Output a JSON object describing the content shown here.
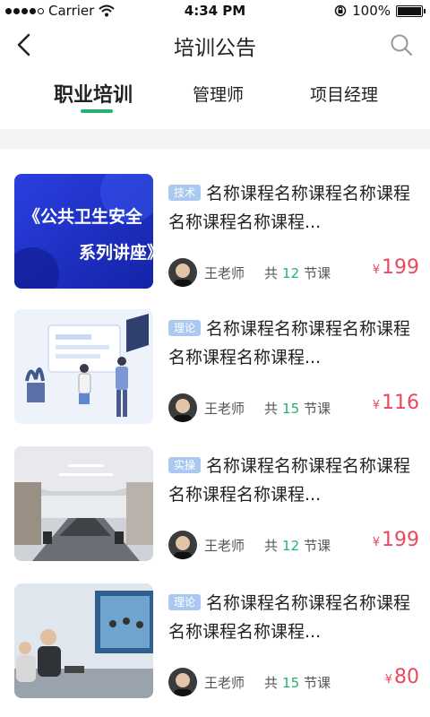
{
  "status_bar": {
    "carrier": "Carrier",
    "time": "4:34 PM",
    "battery": "100%"
  },
  "header": {
    "title": "培训公告",
    "back_icon": "back-icon",
    "search_icon": "search-icon"
  },
  "tabs": [
    {
      "label": "职业培训",
      "active": true
    },
    {
      "label": "管理师",
      "active": false
    },
    {
      "label": "项目经理",
      "active": false
    }
  ],
  "courses": [
    {
      "tag": "技术",
      "title": "名称课程名称课程名称课程名称课程名称课程...",
      "teacher": "王老师",
      "lessons_prefix": "共",
      "lessons_count": "12",
      "lessons_suffix": "节课",
      "currency": "¥",
      "price": "199",
      "thumb_text_line1": "《公共卫生安全",
      "thumb_text_line2": "系列讲座》"
    },
    {
      "tag": "理论",
      "title": "名称课程名称课程名称课程名称课程名称课程...",
      "teacher": "王老师",
      "lessons_prefix": "共",
      "lessons_count": "15",
      "lessons_suffix": "节课",
      "currency": "¥",
      "price": "116"
    },
    {
      "tag": "实操",
      "title": "名称课程名称课程名称课程名称课程名称课程...",
      "teacher": "王老师",
      "lessons_prefix": "共",
      "lessons_count": "12",
      "lessons_suffix": "节课",
      "currency": "¥",
      "price": "199"
    },
    {
      "tag": "理论",
      "title": "名称课程名称课程名称课程名称课程名称课程...",
      "teacher": "王老师",
      "lessons_prefix": "共",
      "lessons_count": "15",
      "lessons_suffix": "节课",
      "currency": "¥",
      "price": "80"
    }
  ],
  "colors": {
    "accent": "#23b26d",
    "price": "#e9495e",
    "tag": "#a9c9f1"
  }
}
